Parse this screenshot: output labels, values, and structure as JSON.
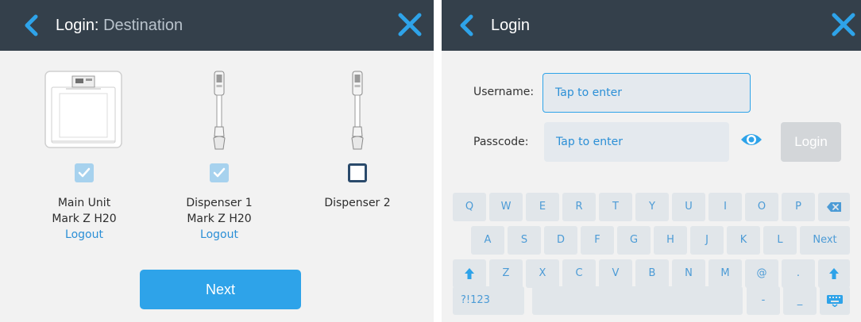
{
  "left": {
    "header": {
      "title_main": "Login:",
      "title_sub": "Destination"
    },
    "devices": [
      {
        "checked": true,
        "line1": "Main Unit",
        "line2": "Mark Z H20",
        "link": "Logout"
      },
      {
        "checked": true,
        "line1": "Dispenser 1",
        "line2": "Mark Z H20",
        "link": "Logout"
      },
      {
        "checked": false,
        "line1": "Dispenser 2",
        "line2": "",
        "link": ""
      }
    ],
    "next_label": "Next"
  },
  "right": {
    "header": {
      "title": "Login"
    },
    "username": {
      "label": "Username:",
      "placeholder": "Tap to enter"
    },
    "passcode": {
      "label": "Passcode:",
      "placeholder": "Tap to enter"
    },
    "login_label": "Login",
    "keyboard": {
      "row1": [
        "Q",
        "W",
        "E",
        "R",
        "T",
        "Y",
        "U",
        "I",
        "O",
        "P"
      ],
      "row2": [
        "A",
        "S",
        "D",
        "F",
        "G",
        "H",
        "J",
        "K",
        "L"
      ],
      "row2_action": "Next",
      "row3": [
        "Z",
        "X",
        "C",
        "V",
        "B",
        "N",
        "M",
        "@",
        "."
      ],
      "row4": {
        "symbols": "?!123",
        "dash": "-",
        "underscore": "_"
      }
    }
  },
  "colors": {
    "header_bg": "#34404b",
    "accent": "#2ea3e9",
    "link": "#2b8fd6",
    "panel_bg": "#f2f2f2",
    "key_bg": "#e1e6ea",
    "key_text": "#4c9bd6"
  },
  "icons": [
    "chevron-left-icon",
    "close-icon",
    "checkbox-checked-icon",
    "checkbox-empty-icon",
    "eye-icon",
    "backspace-icon",
    "shift-icon",
    "keyboard-hide-icon"
  ]
}
